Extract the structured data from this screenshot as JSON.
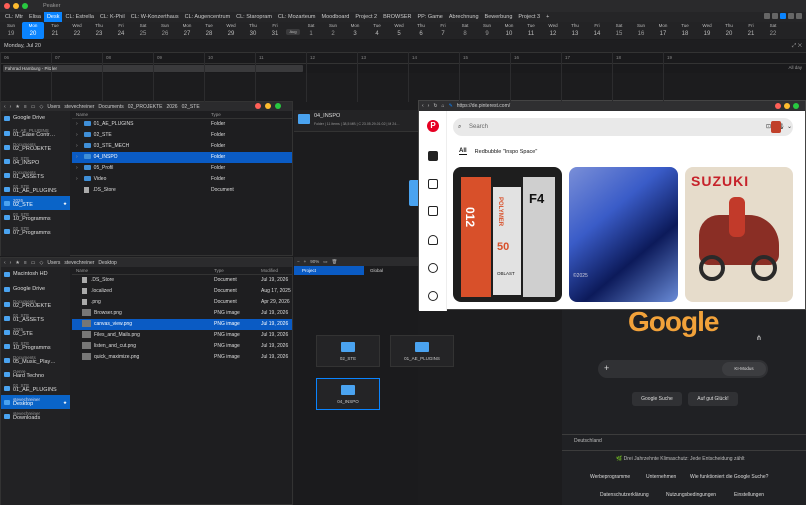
{
  "app": {
    "title": "Peaker"
  },
  "tabs": [
    "CL: Mtr",
    "Elisa",
    "Desk",
    "CL: Estrella",
    "CL: K-Phil",
    "CL: W-Konzerthaus",
    "CL: Augencentrum",
    "CL: Staropram",
    "CL: Mozarteum",
    "Moodboard",
    "Project 2",
    "BROWSER",
    "PP: Game",
    "Abrechnung",
    "Bewerbung",
    "Project 3",
    "+"
  ],
  "active_tab": "Desk",
  "days": [
    {
      "n": "Sun",
      "d": "19"
    },
    {
      "n": "Mon",
      "d": "20"
    },
    {
      "n": "Tue",
      "d": "21"
    },
    {
      "n": "Wed",
      "d": "22"
    },
    {
      "n": "Thu",
      "d": "23"
    },
    {
      "n": "Fri",
      "d": "24"
    },
    {
      "n": "Sat",
      "d": "25"
    },
    {
      "n": "Sun",
      "d": "26"
    },
    {
      "n": "Mon",
      "d": "27"
    },
    {
      "n": "Tue",
      "d": "28"
    },
    {
      "n": "Wed",
      "d": "29"
    },
    {
      "n": "Thu",
      "d": "30"
    },
    {
      "n": "Fri",
      "d": "31"
    },
    {
      "n": "",
      "d": "Aug"
    },
    {
      "n": "Sat",
      "d": "1"
    },
    {
      "n": "Sun",
      "d": "2"
    },
    {
      "n": "Mon",
      "d": "3"
    },
    {
      "n": "Tue",
      "d": "4"
    },
    {
      "n": "Wed",
      "d": "5"
    },
    {
      "n": "Thu",
      "d": "6"
    },
    {
      "n": "Fri",
      "d": "7"
    },
    {
      "n": "Sat",
      "d": "8"
    },
    {
      "n": "Sun",
      "d": "9"
    },
    {
      "n": "Mon",
      "d": "10"
    },
    {
      "n": "Tue",
      "d": "11"
    },
    {
      "n": "Wed",
      "d": "12"
    },
    {
      "n": "Thu",
      "d": "13"
    },
    {
      "n": "Fri",
      "d": "14"
    },
    {
      "n": "Sat",
      "d": "15"
    },
    {
      "n": "Sun",
      "d": "16"
    },
    {
      "n": "Mon",
      "d": "17"
    },
    {
      "n": "Tue",
      "d": "18"
    },
    {
      "n": "Wed",
      "d": "19"
    },
    {
      "n": "Thu",
      "d": "20"
    },
    {
      "n": "Fri",
      "d": "21"
    },
    {
      "n": "Sat",
      "d": "22"
    }
  ],
  "calendar": {
    "date_label": "Monday, Jul 20",
    "hours": [
      "06",
      "07",
      "08",
      "09",
      "10",
      "11",
      "12",
      "13",
      "14",
      "15",
      "16",
      "17",
      "18",
      "19"
    ],
    "allday_event": "Fahrrad Hamburg - Pitzler",
    "allday_label": "All day"
  },
  "finder1": {
    "crumbs": [
      "Users",
      "stevechreiner",
      "Documents",
      "02_PROJEKTE",
      "2026",
      "02_STE"
    ],
    "sidebar": [
      {
        "sub": "",
        "title": "Google Drive"
      },
      {
        "sub": "01_AE_PLUGINS",
        "title": "01_Ease Contr…"
      },
      {
        "sub": "Documents",
        "title": "02_PROJEKTE"
      },
      {
        "sub": "02_STE",
        "title": "04_INSPO"
      },
      {
        "sub": "Documents",
        "title": "01_ASSETS"
      },
      {
        "sub": "02_STE",
        "title": "01_AE_PLUGINS"
      },
      {
        "sub": "2026",
        "title": "02_STE",
        "sel": true
      },
      {
        "sub": "02_STE",
        "title": "10_Programms"
      },
      {
        "sub": "02_STE",
        "title": "07_Programms"
      }
    ],
    "headers": {
      "name": "Name",
      "type": "Type"
    },
    "rows": [
      {
        "name": "01_AE_PLUGINS",
        "type": "Folder",
        "kind": "fold"
      },
      {
        "name": "02_STE",
        "type": "Folder",
        "kind": "fold"
      },
      {
        "name": "03_STE_MECH",
        "type": "Folder",
        "kind": "fold"
      },
      {
        "name": "04_INSPO",
        "type": "Folder",
        "kind": "fold",
        "sel": true
      },
      {
        "name": "05_Profil",
        "type": "Folder",
        "kind": "fold"
      },
      {
        "name": "Video",
        "type": "Folder",
        "kind": "fold"
      },
      {
        "name": ".DS_Store",
        "type": "Document",
        "kind": "doc"
      }
    ],
    "preview_title": "04_INSPO",
    "preview_meta": "Folder | 11 items | 38,5 MB | C 23.05.29-01:02 | M 24…"
  },
  "finder2": {
    "crumbs": [
      "Users",
      "stevechreiner",
      "Desktop"
    ],
    "sidebar": [
      {
        "sub": "",
        "title": "Macintosh HD"
      },
      {
        "sub": "",
        "title": "Google Drive"
      },
      {
        "sub": "Documents",
        "title": "02_PROJEKTE"
      },
      {
        "sub": "02_STE",
        "title": "01_ASSETS"
      },
      {
        "sub": "2026",
        "title": "02_STE"
      },
      {
        "sub": "02_STE",
        "title": "10_Programms"
      },
      {
        "sub": "Documents",
        "title": "05_Music_Play…"
      },
      {
        "sub": "Genre",
        "title": "Hard Techno"
      },
      {
        "sub": "02_STE",
        "title": "01_AE_PLUGINS"
      },
      {
        "sub": "stevechreiner",
        "title": "Desktop",
        "sel": true
      },
      {
        "sub": "stevechreiner",
        "title": "Downloads"
      }
    ],
    "headers": {
      "name": "Name",
      "type": "Type",
      "mod": "Modified"
    },
    "rows": [
      {
        "name": ".DS_Store",
        "type": "Document",
        "mod": "Jul 19, 2026",
        "kind": "doc"
      },
      {
        "name": ".localized",
        "type": "Document",
        "mod": "Aug 17, 2025",
        "kind": "doc"
      },
      {
        "name": ".png",
        "type": "Document",
        "mod": "Apr 29, 2026",
        "kind": "doc"
      },
      {
        "name": "Browser.png",
        "type": "PNG image",
        "mod": "Jul 19, 2026",
        "kind": "img"
      },
      {
        "name": "canvas_view.png",
        "type": "PNG image",
        "mod": "Jul 19, 2026",
        "kind": "img",
        "sel": true
      },
      {
        "name": "Files_and_Mails.png",
        "type": "PNG image",
        "mod": "Jul 19, 2026",
        "kind": "img"
      },
      {
        "name": "listen_and_cut.png",
        "type": "PNG image",
        "mod": "Jul 19, 2026",
        "kind": "img"
      },
      {
        "name": "quick_maximize.png",
        "type": "PNG image",
        "mod": "Jul 19, 2026",
        "kind": "img"
      }
    ]
  },
  "canvas": {
    "zoom": "90%",
    "tabs": [
      "Project",
      "Global"
    ],
    "folders": [
      {
        "name": "02_STE"
      },
      {
        "name": "01_AE_PLUGINS"
      },
      {
        "name": "04_INSPO",
        "sel": true
      }
    ]
  },
  "pinterest": {
    "url": "https://de.pinterest.com/",
    "search_placeholder": "Search",
    "tab_all": "All",
    "tab_board": "Redbubble \"Inspo Space\"",
    "card1": {
      "t1": "012",
      "t2": "POLYMER",
      "t3": "F4",
      "t4": "50",
      "t5": "OBLAST"
    },
    "card2": {
      "t1": "©2025"
    },
    "card3": {
      "t1": "SUZUKI"
    }
  },
  "google": {
    "logo": "Google",
    "ki_mode": "KI-Modus",
    "btn_search": "Google Suche",
    "btn_lucky": "Auf gut Glück!",
    "country": "Deutschland",
    "climate": "Drei Jahrzehnte Klimaschutz: Jede Entscheidung zählt",
    "footer1": [
      "Werbeprogramme",
      "Unternehmen",
      "Wie funktioniert die Google Suche?"
    ],
    "footer2": [
      "Datenschutzerklärung",
      "Nutzungsbedingungen",
      "Einstellungen"
    ]
  }
}
